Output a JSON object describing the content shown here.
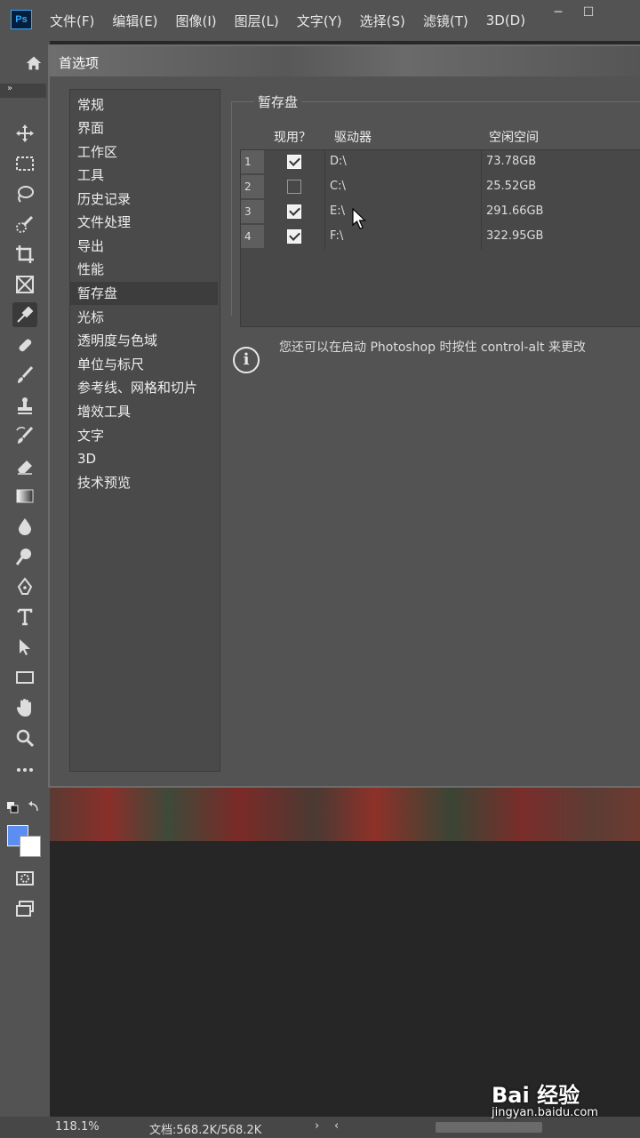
{
  "app": {
    "logo": "Ps"
  },
  "menu": [
    "文件(F)",
    "编辑(E)",
    "图像(I)",
    "图层(L)",
    "文字(Y)",
    "选择(S)",
    "滤镜(T)",
    "3D(D)"
  ],
  "window_controls": {
    "minimize": "─",
    "maximize": "☐"
  },
  "collapse_glyph": "»",
  "dialog": {
    "title": "首选项",
    "nav": [
      "常规",
      "界面",
      "工作区",
      "工具",
      "历史记录",
      "文件处理",
      "导出",
      "性能",
      "暂存盘",
      "光标",
      "透明度与色域",
      "单位与标尺",
      "参考线、网格和切片",
      "增效工具",
      "文字",
      "3D",
      "技术预览"
    ],
    "selected_nav": "暂存盘",
    "section_title": "暂存盘",
    "columns": {
      "active": "现用？",
      "drive": "驱动器",
      "free": "空闲空间"
    },
    "rows": [
      {
        "num": "1",
        "checked": true,
        "drive": "D:\\",
        "free": "73.78GB"
      },
      {
        "num": "2",
        "checked": false,
        "drive": "C:\\",
        "free": "25.52GB"
      },
      {
        "num": "3",
        "checked": true,
        "drive": "E:\\",
        "free": "291.66GB"
      },
      {
        "num": "4",
        "checked": true,
        "drive": "F:\\",
        "free": "322.95GB"
      }
    ],
    "info_icon": "i",
    "info_text": "您还可以在启动 Photoshop 时按住 control-alt 来更改"
  },
  "status": {
    "zoom": "118.1%",
    "doc": "文档:568.2K/568.2K",
    "arrow_right": "›",
    "arrow_left": "‹"
  },
  "watermark": {
    "brand": "Bai 经验",
    "url": "jingyan.baidu.com"
  },
  "colors": {
    "foreground": "#5c8ef2",
    "background": "#ffffff",
    "accent": "#31a8ff"
  }
}
